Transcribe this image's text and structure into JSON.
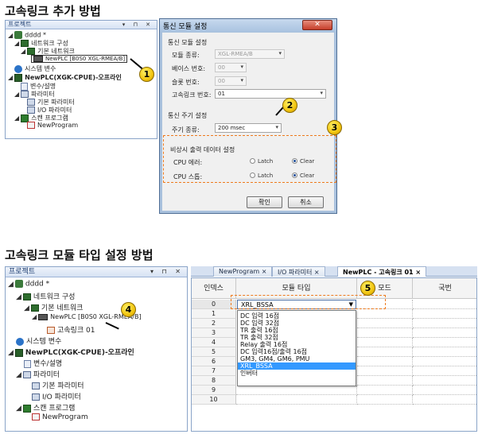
{
  "sections": {
    "top_heading": "고속링크 추가 방법",
    "bottom_heading": "고속링크 모듈 타입 설정 방법"
  },
  "top_tree": {
    "title": "프로젝트",
    "controls": "▾ ⊓ ✕",
    "items": [
      {
        "label": "dddd *"
      },
      {
        "label": "네트워크 구성"
      },
      {
        "label": "기본 네트워크"
      },
      {
        "label": "NewPLC [B0S0 XGL-RMEA/B]"
      },
      {
        "label": "시스템 변수"
      },
      {
        "label": "NewPLC(XGK-CPUE)-오프라인"
      },
      {
        "label": "변수/설명"
      },
      {
        "label": "파라미터"
      },
      {
        "label": "기본 파라미터"
      },
      {
        "label": "I/O 파라미터"
      },
      {
        "label": "스캔 프로그램"
      },
      {
        "label": "NewProgram"
      }
    ]
  },
  "dialog": {
    "title": "통신 모듈 설정",
    "close": "✕",
    "group1_title": "통신 모듈 설정",
    "module_type_label": "모듈 종류:",
    "module_type_value": "XGL-RMEA/B",
    "base_label": "베이스 번호:",
    "base_value": "00",
    "slot_label": "슬롯 번호:",
    "slot_value": "00",
    "link_label": "고속링크 번호:",
    "link_value": "01",
    "group2_title": "통신 주기 설정",
    "period_label": "주기 종류:",
    "period_value": "200 msec",
    "group3_title": "비상시 출력 데이터 설정",
    "cpu_error_label": "CPU 에러:",
    "cpu_stop_label": "CPU 스톱:",
    "latch": "Latch",
    "clear": "Clear",
    "ok": "확인",
    "cancel": "취소"
  },
  "callouts": [
    "1",
    "2",
    "3",
    "4",
    "5"
  ],
  "bottom_tree": {
    "title": "프로젝트",
    "controls": "▾ ⊓ ✕",
    "items": [
      {
        "label": "dddd *"
      },
      {
        "label": "네트워크 구성"
      },
      {
        "label": "기본 네트워크"
      },
      {
        "label": "NewPLC [B0S0 XGL-RMEA/B]"
      },
      {
        "label": "고속링크 01"
      },
      {
        "label": "시스템 변수"
      },
      {
        "label": "NewPLC(XGK-CPUE)-오프라인"
      },
      {
        "label": "변수/설명"
      },
      {
        "label": "파라미터"
      },
      {
        "label": "기본 파라미터"
      },
      {
        "label": "I/O 파라미터"
      },
      {
        "label": "스캔 프로그램"
      },
      {
        "label": "NewProgram"
      }
    ]
  },
  "tabs": [
    {
      "label": "NewProgram",
      "close": "×"
    },
    {
      "label": "I/O 파라미터",
      "close": "×"
    },
    {
      "label": "NewPLC - 고속링크 01",
      "close": "×"
    }
  ],
  "grid": {
    "col_index": "인덱스",
    "col_type": "모듈 타입",
    "col_mode": "모드",
    "col_ch": "국번",
    "rows": [
      "0",
      "1",
      "2",
      "3",
      "4",
      "5",
      "6",
      "7",
      "8",
      "9",
      "10"
    ],
    "selected_type": "XRL_BSSA",
    "dropdown_options": [
      "DC 입력 16점",
      "DC 입력 32점",
      "TR 출력 16점",
      "TR 출력 32점",
      "Relay 출력 16점",
      "DC 입력16점/출력 16점",
      "GM3, GM4, GM6, PMU",
      "XRL_BSSA",
      "인버터"
    ],
    "dropdown_selected_index": 7
  },
  "colors": {
    "accent_blue": "#3399ff",
    "callout_yellow": "#f1c40f",
    "dashed_orange": "#ee7a1d",
    "panel_border": "#8aa4c8"
  }
}
